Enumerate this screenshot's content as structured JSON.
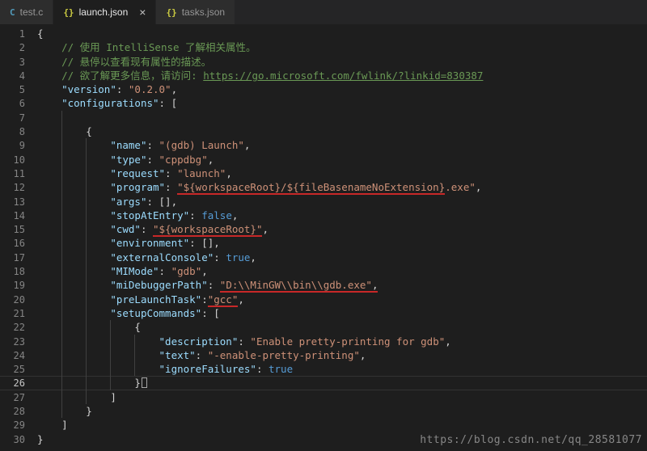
{
  "tabs": [
    {
      "label": "test.c",
      "icon": "c",
      "active": false
    },
    {
      "label": "launch.json",
      "icon": "json",
      "active": true,
      "close": "×"
    },
    {
      "label": "tasks.json",
      "icon": "json",
      "active": false
    }
  ],
  "icons": {
    "c": {
      "glyph": "C",
      "color": "#519aba"
    },
    "json": {
      "glyph": "{}",
      "color": "#cbcb41"
    }
  },
  "editor": {
    "lines": [
      {
        "n": 1,
        "indent": 0,
        "tokens": [
          {
            "t": "{",
            "c": "punc"
          }
        ]
      },
      {
        "n": 2,
        "indent": 4,
        "tokens": [
          {
            "t": "// 使用 IntelliSense 了解相关属性。",
            "c": "cmt"
          }
        ]
      },
      {
        "n": 3,
        "indent": 4,
        "tokens": [
          {
            "t": "// 悬停以查看现有属性的描述。",
            "c": "cmt"
          }
        ]
      },
      {
        "n": 4,
        "indent": 4,
        "tokens": [
          {
            "t": "// 欲了解更多信息，请访问: ",
            "c": "cmt"
          },
          {
            "t": "https://go.microsoft.com/fwlink/?linkid=830387",
            "c": "cmt link"
          }
        ]
      },
      {
        "n": 5,
        "indent": 4,
        "tokens": [
          {
            "t": "\"version\"",
            "c": "key"
          },
          {
            "t": ": ",
            "c": "punc"
          },
          {
            "t": "\"0.2.0\"",
            "c": "str"
          },
          {
            "t": ",",
            "c": "punc"
          }
        ]
      },
      {
        "n": 6,
        "indent": 4,
        "tokens": [
          {
            "t": "\"configurations\"",
            "c": "key"
          },
          {
            "t": ": [",
            "c": "punc"
          }
        ]
      },
      {
        "n": 7,
        "indent": 8,
        "tokens": []
      },
      {
        "n": 8,
        "indent": 8,
        "tokens": [
          {
            "t": "{",
            "c": "punc"
          }
        ]
      },
      {
        "n": 9,
        "indent": 12,
        "tokens": [
          {
            "t": "\"name\"",
            "c": "key"
          },
          {
            "t": ": ",
            "c": "punc"
          },
          {
            "t": "\"(gdb) Launch\"",
            "c": "str"
          },
          {
            "t": ",",
            "c": "punc"
          }
        ]
      },
      {
        "n": 10,
        "indent": 12,
        "tokens": [
          {
            "t": "\"type\"",
            "c": "key"
          },
          {
            "t": ": ",
            "c": "punc"
          },
          {
            "t": "\"cppdbg\"",
            "c": "str"
          },
          {
            "t": ",",
            "c": "punc"
          }
        ]
      },
      {
        "n": 11,
        "indent": 12,
        "tokens": [
          {
            "t": "\"request\"",
            "c": "key"
          },
          {
            "t": ": ",
            "c": "punc"
          },
          {
            "t": "\"launch\"",
            "c": "str"
          },
          {
            "t": ",",
            "c": "punc"
          }
        ]
      },
      {
        "n": 12,
        "indent": 12,
        "tokens": [
          {
            "t": "\"program\"",
            "c": "key"
          },
          {
            "t": ": ",
            "c": "punc"
          },
          {
            "t": "\"${workspaceRoot}/${fileBasenameNoExtension}",
            "c": "str red"
          },
          {
            "t": ".exe\"",
            "c": "str"
          },
          {
            "t": ",",
            "c": "punc"
          }
        ]
      },
      {
        "n": 13,
        "indent": 12,
        "tokens": [
          {
            "t": "\"args\"",
            "c": "key"
          },
          {
            "t": ": [],",
            "c": "punc"
          }
        ]
      },
      {
        "n": 14,
        "indent": 12,
        "tokens": [
          {
            "t": "\"stopAtEntry\"",
            "c": "key"
          },
          {
            "t": ": ",
            "c": "punc"
          },
          {
            "t": "false",
            "c": "bool"
          },
          {
            "t": ",",
            "c": "punc"
          }
        ]
      },
      {
        "n": 15,
        "indent": 12,
        "tokens": [
          {
            "t": "\"cwd\"",
            "c": "key"
          },
          {
            "t": ": ",
            "c": "punc"
          },
          {
            "t": "\"${workspaceRoot}\"",
            "c": "str red"
          },
          {
            "t": ",",
            "c": "punc"
          }
        ]
      },
      {
        "n": 16,
        "indent": 12,
        "tokens": [
          {
            "t": "\"environment\"",
            "c": "key"
          },
          {
            "t": ": [],",
            "c": "punc"
          }
        ]
      },
      {
        "n": 17,
        "indent": 12,
        "tokens": [
          {
            "t": "\"externalConsole\"",
            "c": "key"
          },
          {
            "t": ": ",
            "c": "punc"
          },
          {
            "t": "true",
            "c": "bool"
          },
          {
            "t": ",",
            "c": "punc"
          }
        ]
      },
      {
        "n": 18,
        "indent": 12,
        "tokens": [
          {
            "t": "\"MIMode\"",
            "c": "key"
          },
          {
            "t": ": ",
            "c": "punc"
          },
          {
            "t": "\"gdb\"",
            "c": "str"
          },
          {
            "t": ",",
            "c": "punc"
          }
        ]
      },
      {
        "n": 19,
        "indent": 12,
        "tokens": [
          {
            "t": "\"miDebuggerPath\"",
            "c": "key"
          },
          {
            "t": ": ",
            "c": "punc"
          },
          {
            "t": "\"D:\\\\MinGW\\\\bin\\\\gdb.exe\"",
            "c": "str red"
          },
          {
            "t": ",",
            "c": "punc red"
          }
        ]
      },
      {
        "n": 20,
        "indent": 12,
        "tokens": [
          {
            "t": "\"preLaunchTask\"",
            "c": "key"
          },
          {
            "t": ":",
            "c": "punc"
          },
          {
            "t": "\"gcc\"",
            "c": "str red"
          },
          {
            "t": ",",
            "c": "punc"
          }
        ]
      },
      {
        "n": 21,
        "indent": 12,
        "tokens": [
          {
            "t": "\"setupCommands\"",
            "c": "key"
          },
          {
            "t": ": [",
            "c": "punc"
          }
        ]
      },
      {
        "n": 22,
        "indent": 16,
        "tokens": [
          {
            "t": "{",
            "c": "punc"
          }
        ]
      },
      {
        "n": 23,
        "indent": 20,
        "tokens": [
          {
            "t": "\"description\"",
            "c": "key"
          },
          {
            "t": ": ",
            "c": "punc"
          },
          {
            "t": "\"Enable pretty-printing for gdb\"",
            "c": "str"
          },
          {
            "t": ",",
            "c": "punc"
          }
        ]
      },
      {
        "n": 24,
        "indent": 20,
        "tokens": [
          {
            "t": "\"text\"",
            "c": "key"
          },
          {
            "t": ": ",
            "c": "punc"
          },
          {
            "t": "\"-enable-pretty-printing\"",
            "c": "str"
          },
          {
            "t": ",",
            "c": "punc"
          }
        ]
      },
      {
        "n": 25,
        "indent": 20,
        "tokens": [
          {
            "t": "\"ignoreFailures\"",
            "c": "key"
          },
          {
            "t": ": ",
            "c": "punc"
          },
          {
            "t": "true",
            "c": "bool"
          }
        ]
      },
      {
        "n": 26,
        "indent": 16,
        "tokens": [
          {
            "t": "}",
            "c": "punc"
          }
        ],
        "highlight": true,
        "cursor": true
      },
      {
        "n": 27,
        "indent": 12,
        "tokens": [
          {
            "t": "]",
            "c": "punc"
          }
        ]
      },
      {
        "n": 28,
        "indent": 8,
        "tokens": [
          {
            "t": "}",
            "c": "punc"
          }
        ]
      },
      {
        "n": 29,
        "indent": 4,
        "tokens": [
          {
            "t": "]",
            "c": "punc"
          }
        ]
      },
      {
        "n": 30,
        "indent": 0,
        "tokens": [
          {
            "t": "}",
            "c": "punc"
          }
        ]
      }
    ]
  },
  "watermark": "https://blog.csdn.net/qq_28581077",
  "colors": {
    "bg": "#1e1e1e",
    "tabbar_bg": "#252526",
    "tab_bg": "#2d2d2d",
    "tab_fg": "#969696",
    "tab_active_fg": "#e8e8e8",
    "key": "#9cdcfe",
    "str": "#ce9178",
    "bool": "#569cd6",
    "cmt": "#6a9955",
    "punc": "#d4d4d4",
    "ln": "#858585",
    "ln_active": "#c6c6c6",
    "guide": "#404040",
    "red": "#c82828",
    "highlight_border": "#333333",
    "watermark": "#9a9a9a"
  }
}
